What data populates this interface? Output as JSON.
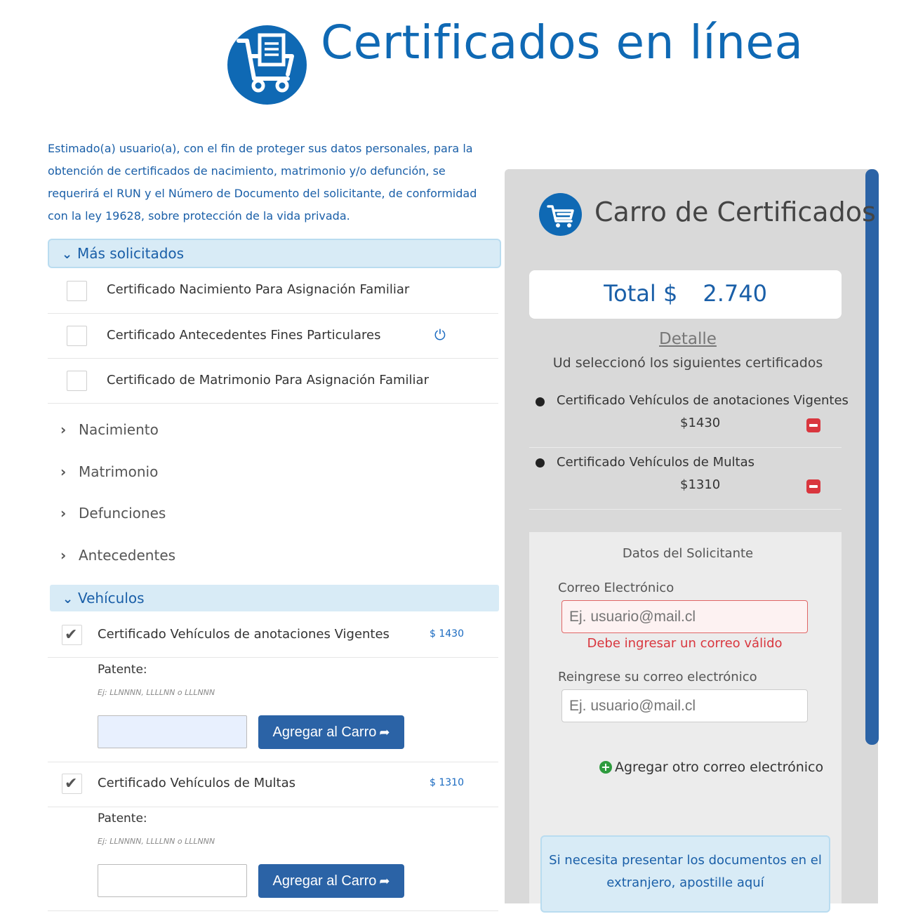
{
  "header": {
    "title": "Certificados en línea",
    "logo_icon": "cart-document-icon"
  },
  "intro": "Estimado(a) usuario(a), con el fin de proteger sus datos personales, para la obtención de certificados de nacimiento, matrimonio y/o defunción, se requerirá el RUN y el Número de Documento del solicitante, de conformidad con la ley 19628, sobre protección de la vida privada.",
  "popular": {
    "label": "Más solicitados",
    "items": [
      {
        "label": "Certificado Nacimiento Para Asignación Familiar",
        "checked": false
      },
      {
        "label": "Certificado Antecedentes Fines Particulares",
        "checked": false,
        "icon": "power-icon"
      },
      {
        "label": "Certificado de Matrimonio Para Asignación Familiar",
        "checked": false
      }
    ]
  },
  "categories": [
    "Nacimiento",
    "Matrimonio",
    "Defunciones",
    "Antecedentes"
  ],
  "vehicles": {
    "label": "Vehículos",
    "items": [
      {
        "label": "Certificado Vehículos de anotaciones Vigentes",
        "price": "$ 1430",
        "checked": true,
        "patente_label": "Patente:",
        "patente_hint": "Ej: LLNNNN, LLLLNN o LLLNNN",
        "button": "Agregar al Carro"
      },
      {
        "label": "Certificado Vehículos de Multas",
        "price": "$ 1310",
        "checked": true,
        "patente_label": "Patente:",
        "patente_hint": "Ej: LLNNNN, LLLLNN o LLLNNN",
        "button": "Agregar al Carro"
      }
    ]
  },
  "cart": {
    "title": "Carro de Certificados",
    "total_label": "Total $",
    "total_value": "2.740",
    "detail_label": "Detalle",
    "detail_sub": "Ud seleccionó los siguientes certificados",
    "items": [
      {
        "name": "Certificado Vehículos de anotaciones Vigentes",
        "price": "$1430"
      },
      {
        "name": "Certificado Vehículos de Multas",
        "price": "$1310"
      }
    ],
    "form": {
      "title": "Datos del Solicitante",
      "email_label": "Correo Electrónico",
      "email_placeholder": "Ej. usuario@mail.cl",
      "email_error": "Debe ingresar un correo válido",
      "reemail_label": "Reingrese su correo electrónico",
      "reemail_placeholder": "Ej. usuario@mail.cl",
      "add_email": "Agregar otro correo electrónico"
    },
    "apostille": "Si necesita presentar los documentos en el extranjero, apostille aquí"
  },
  "colors": {
    "brand": "#0f69b4",
    "button": "#2b63a6",
    "error": "#d9363e",
    "panel": "#d9d9d9"
  }
}
